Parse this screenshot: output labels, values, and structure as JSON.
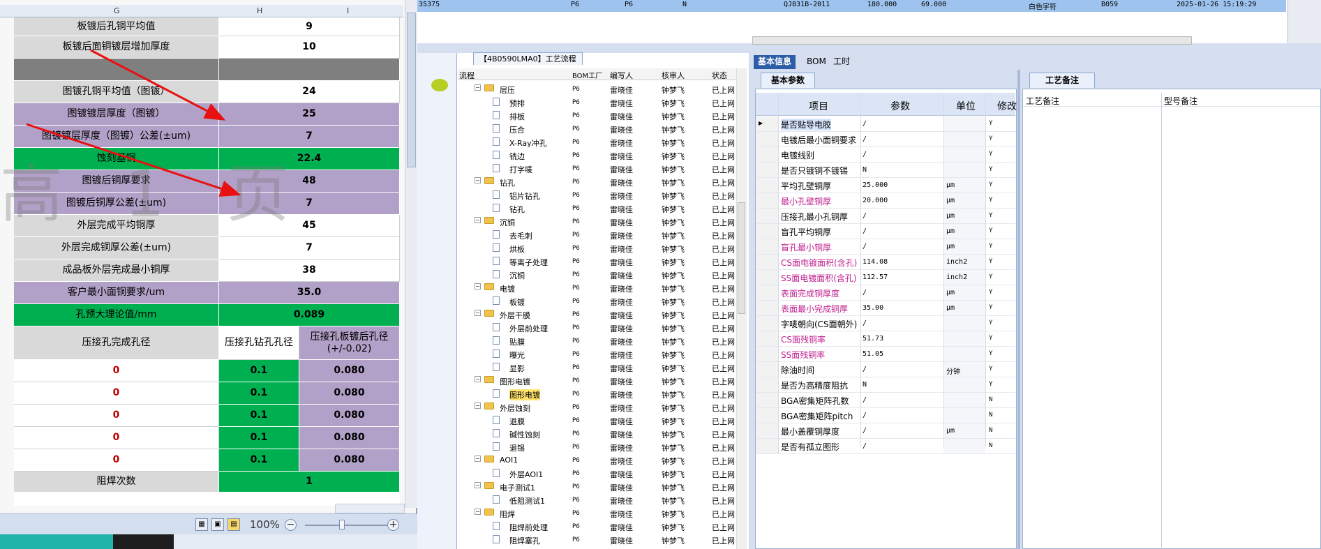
{
  "top_record": {
    "cells": [
      "35375",
      "P6",
      "P6",
      "N",
      "QJ831B-2011",
      "180.000",
      "69.000",
      "白色字符",
      "B059",
      "2025-01-26 15:19:29"
    ]
  },
  "tree_panel": {
    "tab_label": "【4B0590LMA0】工艺流程",
    "headers": {
      "name": "流程",
      "factory": "BOM工厂",
      "writer": "编写人",
      "reviewer": "核审人",
      "status": "状态"
    },
    "rows": [
      {
        "level": 0,
        "type": "folder",
        "name": "层压",
        "factory": "P6",
        "writer": "雷晓佳",
        "reviewer": "钟梦飞",
        "status": "已上网"
      },
      {
        "level": 1,
        "type": "doc",
        "name": "预排",
        "factory": "P6",
        "writer": "雷晓佳",
        "reviewer": "钟梦飞",
        "status": "已上网"
      },
      {
        "level": 1,
        "type": "doc",
        "name": "排板",
        "factory": "P6",
        "writer": "雷晓佳",
        "reviewer": "钟梦飞",
        "status": "已上网"
      },
      {
        "level": 1,
        "type": "doc",
        "name": "压合",
        "factory": "P6",
        "writer": "雷晓佳",
        "reviewer": "钟梦飞",
        "status": "已上网"
      },
      {
        "level": 1,
        "type": "doc",
        "name": "X-Ray冲孔",
        "factory": "P6",
        "writer": "雷晓佳",
        "reviewer": "钟梦飞",
        "status": "已上网"
      },
      {
        "level": 1,
        "type": "doc",
        "name": "铣边",
        "factory": "P6",
        "writer": "雷晓佳",
        "reviewer": "钟梦飞",
        "status": "已上网"
      },
      {
        "level": 1,
        "type": "doc",
        "name": "打字唛",
        "factory": "P6",
        "writer": "雷晓佳",
        "reviewer": "钟梦飞",
        "status": "已上网"
      },
      {
        "level": 0,
        "type": "folder",
        "name": "钻孔",
        "factory": "P6",
        "writer": "雷晓佳",
        "reviewer": "钟梦飞",
        "status": "已上网"
      },
      {
        "level": 1,
        "type": "doc",
        "name": "铝片钻孔",
        "factory": "P6",
        "writer": "雷晓佳",
        "reviewer": "钟梦飞",
        "status": "已上网"
      },
      {
        "level": 1,
        "type": "doc",
        "name": "钻孔",
        "factory": "P6",
        "writer": "雷晓佳",
        "reviewer": "钟梦飞",
        "status": "已上网"
      },
      {
        "level": 0,
        "type": "folder",
        "name": "沉铜",
        "factory": "P6",
        "writer": "雷晓佳",
        "reviewer": "钟梦飞",
        "status": "已上网"
      },
      {
        "level": 1,
        "type": "doc",
        "name": "去毛刺",
        "factory": "P6",
        "writer": "雷晓佳",
        "reviewer": "钟梦飞",
        "status": "已上网"
      },
      {
        "level": 1,
        "type": "doc",
        "name": "烘板",
        "factory": "P6",
        "writer": "雷晓佳",
        "reviewer": "钟梦飞",
        "status": "已上网"
      },
      {
        "level": 1,
        "type": "doc",
        "name": "等离子处理",
        "factory": "P6",
        "writer": "雷晓佳",
        "reviewer": "钟梦飞",
        "status": "已上网"
      },
      {
        "level": 1,
        "type": "doc",
        "name": "沉铜",
        "factory": "P6",
        "writer": "雷晓佳",
        "reviewer": "钟梦飞",
        "status": "已上网"
      },
      {
        "level": 0,
        "type": "folder",
        "name": "电镀",
        "factory": "P6",
        "writer": "雷晓佳",
        "reviewer": "钟梦飞",
        "status": "已上网"
      },
      {
        "level": 1,
        "type": "doc",
        "name": "板镀",
        "factory": "P6",
        "writer": "雷晓佳",
        "reviewer": "钟梦飞",
        "status": "已上网"
      },
      {
        "level": 0,
        "type": "folder",
        "name": "外层干膜",
        "factory": "P6",
        "writer": "雷晓佳",
        "reviewer": "钟梦飞",
        "status": "已上网"
      },
      {
        "level": 1,
        "type": "doc",
        "name": "外层前处理",
        "factory": "P6",
        "writer": "雷晓佳",
        "reviewer": "钟梦飞",
        "status": "已上网"
      },
      {
        "level": 1,
        "type": "doc",
        "name": "贴膜",
        "factory": "P6",
        "writer": "雷晓佳",
        "reviewer": "钟梦飞",
        "status": "已上网"
      },
      {
        "level": 1,
        "type": "doc",
        "name": "曝光",
        "factory": "P6",
        "writer": "雷晓佳",
        "reviewer": "钟梦飞",
        "status": "已上网"
      },
      {
        "level": 1,
        "type": "doc",
        "name": "显影",
        "factory": "P6",
        "writer": "雷晓佳",
        "reviewer": "钟梦飞",
        "status": "已上网"
      },
      {
        "level": 0,
        "type": "folder",
        "name": "图形电镀",
        "factory": "P6",
        "writer": "雷晓佳",
        "reviewer": "钟梦飞",
        "status": "已上网"
      },
      {
        "level": 1,
        "type": "doc",
        "name": "图形电镀",
        "factory": "P6",
        "writer": "雷晓佳",
        "reviewer": "钟梦飞",
        "status": "已上网",
        "selected": true
      },
      {
        "level": 0,
        "type": "folder",
        "name": "外层蚀刻",
        "factory": "P6",
        "writer": "雷晓佳",
        "reviewer": "钟梦飞",
        "status": "已上网"
      },
      {
        "level": 1,
        "type": "doc",
        "name": "退膜",
        "factory": "P6",
        "writer": "雷晓佳",
        "reviewer": "钟梦飞",
        "status": "已上网"
      },
      {
        "level": 1,
        "type": "doc",
        "name": "碱性蚀刻",
        "factory": "P6",
        "writer": "雷晓佳",
        "reviewer": "钟梦飞",
        "status": "已上网"
      },
      {
        "level": 1,
        "type": "doc",
        "name": "退锡",
        "factory": "P6",
        "writer": "雷晓佳",
        "reviewer": "钟梦飞",
        "status": "已上网"
      },
      {
        "level": 0,
        "type": "folder",
        "name": "AOI1",
        "factory": "P6",
        "writer": "雷晓佳",
        "reviewer": "钟梦飞",
        "status": "已上网"
      },
      {
        "level": 1,
        "type": "doc",
        "name": "外层AOI1",
        "factory": "P6",
        "writer": "雷晓佳",
        "reviewer": "钟梦飞",
        "status": "已上网"
      },
      {
        "level": 0,
        "type": "folder",
        "name": "电子测试1",
        "factory": "P6",
        "writer": "雷晓佳",
        "reviewer": "钟梦飞",
        "status": "已上网"
      },
      {
        "level": 1,
        "type": "doc",
        "name": "低阻测试1",
        "factory": "P6",
        "writer": "雷晓佳",
        "reviewer": "钟梦飞",
        "status": "已上网"
      },
      {
        "level": 0,
        "type": "folder",
        "name": "阻焊",
        "factory": "P6",
        "writer": "雷晓佳",
        "reviewer": "钟梦飞",
        "status": "已上网"
      },
      {
        "level": 1,
        "type": "doc",
        "name": "阻焊前处理",
        "factory": "P6",
        "writer": "雷晓佳",
        "reviewer": "钟梦飞",
        "status": "已上网"
      },
      {
        "level": 1,
        "type": "doc",
        "name": "阻焊塞孔",
        "factory": "P6",
        "writer": "雷晓佳",
        "reviewer": "钟梦飞",
        "status": "已上网"
      }
    ]
  },
  "info_panel": {
    "tabs": [
      "基本信息",
      "BOM",
      "工时"
    ],
    "active_tab": 0,
    "sub_tab": "基本参数",
    "headers": {
      "item": "项目",
      "param": "参数",
      "unit": "单位",
      "modify": "修改"
    },
    "rows": [
      {
        "name": "是否贴导电胶",
        "value": "/",
        "unit": "",
        "flag": "Y",
        "magenta": false,
        "current": true
      },
      {
        "name": "电镀后最小面铜要求",
        "value": "/",
        "unit": "",
        "flag": "Y",
        "magenta": false
      },
      {
        "name": "电镀线别",
        "value": "/",
        "unit": "",
        "flag": "Y",
        "magenta": false
      },
      {
        "name": "是否只镀铜不镀锡",
        "value": "N",
        "unit": "",
        "flag": "Y",
        "magenta": false
      },
      {
        "name": "平均孔壁铜厚",
        "value": "25.000",
        "unit": "μm",
        "flag": "Y",
        "magenta": false
      },
      {
        "name": "最小孔壁铜厚",
        "value": "20.000",
        "unit": "μm",
        "flag": "Y",
        "magenta": true
      },
      {
        "name": "压接孔最小孔铜厚",
        "value": "/",
        "unit": "μm",
        "flag": "Y",
        "magenta": false
      },
      {
        "name": "盲孔平均铜厚",
        "value": "/",
        "unit": "μm",
        "flag": "Y",
        "magenta": false
      },
      {
        "name": "盲孔最小铜厚",
        "value": "/",
        "unit": "μm",
        "flag": "Y",
        "magenta": true
      },
      {
        "name": "CS面电镀面积(含孔)",
        "value": "114.08",
        "unit": "inch2",
        "flag": "Y",
        "magenta": true
      },
      {
        "name": "SS面电镀面积(含孔)",
        "value": "112.57",
        "unit": "inch2",
        "flag": "Y",
        "magenta": true
      },
      {
        "name": "表面完成铜厚度",
        "value": "/",
        "unit": "μm",
        "flag": "Y",
        "magenta": true
      },
      {
        "name": "表面最小完成铜厚",
        "value": "35.00",
        "unit": "μm",
        "flag": "Y",
        "magenta": true
      },
      {
        "name": "字唛朝向(CS面朝外)",
        "value": "/",
        "unit": "",
        "flag": "Y",
        "magenta": false
      },
      {
        "name": "CS面残铜率",
        "value": "51.73",
        "unit": "",
        "flag": "Y",
        "magenta": true
      },
      {
        "name": "SS面残铜率",
        "value": "51.05",
        "unit": "",
        "flag": "Y",
        "magenta": true
      },
      {
        "name": "除油时间",
        "value": "/",
        "unit": "分钟",
        "flag": "Y",
        "magenta": false
      },
      {
        "name": "是否为高精度阻抗",
        "value": "N",
        "unit": "",
        "flag": "Y",
        "magenta": false
      },
      {
        "name": "BGA密集矩阵孔数",
        "value": "/",
        "unit": "",
        "flag": "N",
        "magenta": false
      },
      {
        "name": "BGA密集矩阵pitch",
        "value": "/",
        "unit": "",
        "flag": "N",
        "magenta": false
      },
      {
        "name": "最小盖覆铜厚度",
        "value": "/",
        "unit": "μm",
        "flag": "N",
        "magenta": false
      },
      {
        "name": "是否有孤立图形",
        "value": "/",
        "unit": "",
        "flag": "N",
        "magenta": false
      }
    ]
  },
  "remark_panel": {
    "tab": "工艺备注",
    "col1": "工艺备注",
    "col2": "型号备注"
  },
  "excel": {
    "columns": [
      "G",
      "H",
      "I"
    ],
    "rows": [
      {
        "label": "板镀后孔铜平均值",
        "value": "9",
        "style": "lg"
      },
      {
        "label": "板镀后面铜镀层增加厚度",
        "value": "10",
        "style": "lg"
      },
      {
        "label": "",
        "value": "",
        "style": "dg"
      },
      {
        "label": "图镀孔铜平均值（图镀）",
        "value": "24",
        "style": "lg"
      },
      {
        "label": "图镀镀层厚度（图镀）",
        "value": "25",
        "style": "pu"
      },
      {
        "label": "图镀镀层厚度（图镀）公差(±um)",
        "value": "7",
        "style": "pu"
      },
      {
        "label": "蚀刻基铜",
        "value": "22.4",
        "style": "gr"
      },
      {
        "label": "图镀后铜厚要求",
        "value": "48",
        "style": "pu"
      },
      {
        "label": "图镀后铜厚公差(±um)",
        "value": "7",
        "style": "pu"
      },
      {
        "label": "外层完成平均铜厚",
        "value": "45",
        "style": "lg"
      },
      {
        "label": "外层完成铜厚公差(±um)",
        "value": "7",
        "style": "lg"
      },
      {
        "label": "成品板外层完成最小铜厚",
        "value": "38",
        "style": "lg"
      },
      {
        "label": "客户最小面铜要求/um",
        "value": "35.0",
        "style": "pu"
      },
      {
        "label": "孔预大理论值/mm",
        "value": "0.089",
        "style": "gr"
      }
    ],
    "subheader": {
      "g": "压接孔完成孔径",
      "h": "压接孔钻孔孔径",
      "i": "压接孔板镀后孔径\n(+/-0.02)"
    },
    "subrows": [
      {
        "g": "0",
        "h": "0.1",
        "i": "0.080"
      },
      {
        "g": "0",
        "h": "0.1",
        "i": "0.080"
      },
      {
        "g": "0",
        "h": "0.1",
        "i": "0.080"
      },
      {
        "g": "0",
        "h": "0.1",
        "i": "0.080"
      },
      {
        "g": "0",
        "h": "0.1",
        "i": "0.080"
      }
    ],
    "last_row": {
      "label": "阻焊次数",
      "value": "1"
    },
    "zoom": "100%"
  }
}
